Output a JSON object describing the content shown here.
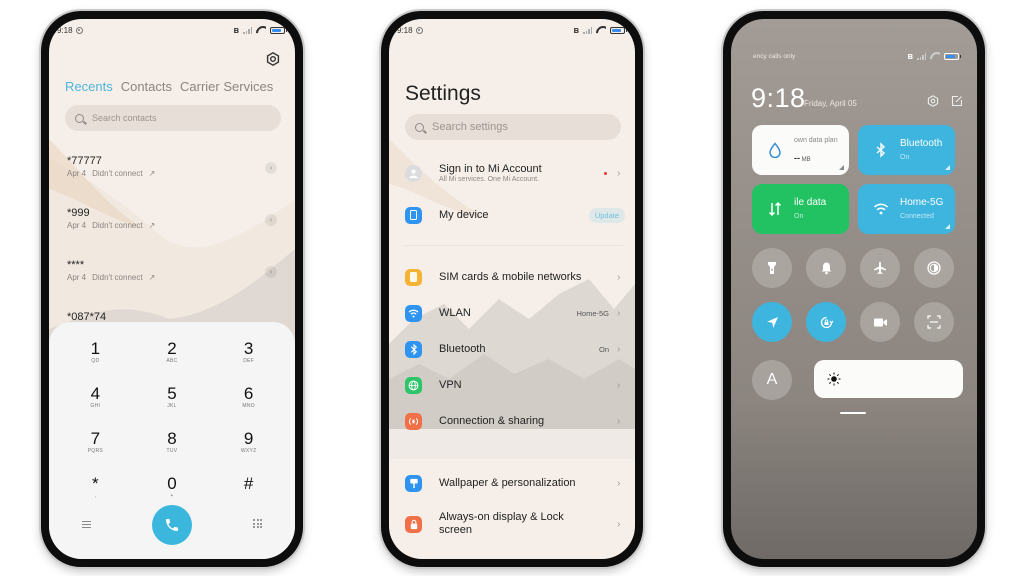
{
  "status_bar": {
    "time": "9:18"
  },
  "phone_app": {
    "tabs": [
      {
        "label": "Recents",
        "active": true
      },
      {
        "label": "Contacts",
        "active": false
      },
      {
        "label": "Carrier Services",
        "active": false
      }
    ],
    "search_placeholder": "Search contacts",
    "recents": [
      {
        "number": "*77777",
        "date": "Apr 4",
        "status": "Didn't connect"
      },
      {
        "number": "*999",
        "date": "Apr 4",
        "status": "Didn't connect"
      },
      {
        "number": "****",
        "date": "Apr 4",
        "status": "Didn't connect"
      },
      {
        "number": "*087*74",
        "date": "",
        "status": ""
      }
    ],
    "keys": [
      {
        "digit": "1",
        "letters": "QD"
      },
      {
        "digit": "2",
        "letters": "ABC"
      },
      {
        "digit": "3",
        "letters": "DEF"
      },
      {
        "digit": "4",
        "letters": "GHI"
      },
      {
        "digit": "5",
        "letters": "JKL"
      },
      {
        "digit": "6",
        "letters": "MNO"
      },
      {
        "digit": "7",
        "letters": "PQRS"
      },
      {
        "digit": "8",
        "letters": "TUV"
      },
      {
        "digit": "9",
        "letters": "WXYZ"
      },
      {
        "digit": "*",
        "letters": ","
      },
      {
        "digit": "0",
        "letters": "+"
      },
      {
        "digit": "#",
        "letters": ""
      }
    ],
    "accent_color": "#3bb6dd"
  },
  "settings_app": {
    "title": "Settings",
    "search_placeholder": "Search settings",
    "account": {
      "label": "Sign in to Mi Account",
      "sub": "All Mi services. One Mi Account."
    },
    "my_device": {
      "label": "My device",
      "badge": "Update"
    },
    "items": [
      {
        "label": "SIM cards & mobile networks",
        "value": "",
        "icon": "sim-card-icon",
        "color": "#f5b335"
      },
      {
        "label": "WLAN",
        "value": "Home-5G",
        "icon": "wifi-icon",
        "color": "#2f93f0"
      },
      {
        "label": "Bluetooth",
        "value": "On",
        "icon": "bluetooth-icon",
        "color": "#2f93f0"
      },
      {
        "label": "VPN",
        "value": "",
        "icon": "globe-icon",
        "color": "#2ec46a"
      },
      {
        "label": "Connection & sharing",
        "value": "",
        "icon": "connection-sharing-icon",
        "color": "#f07048"
      }
    ],
    "personal_items": [
      {
        "label": "Wallpaper & personalization",
        "icon": "wallpaper-icon",
        "color": "#2f93f0"
      },
      {
        "label": "Always-on display & Lock screen",
        "icon": "lock-icon",
        "color": "#f07048"
      }
    ]
  },
  "control_center": {
    "carrier_text": "ency calls only",
    "time": "9:18",
    "date": "Friday, April 05",
    "tiles": {
      "data_plan": {
        "title": "own data plan",
        "value": "--",
        "unit": "MB"
      },
      "bluetooth": {
        "title": "Bluetooth",
        "sub": "On"
      },
      "mobile_data": {
        "title": "ile data",
        "sub": "On"
      },
      "wifi": {
        "title": "Home-5G",
        "sub": "Connected"
      }
    },
    "toggles": [
      {
        "name": "flashlight",
        "on": false
      },
      {
        "name": "silent",
        "on": false
      },
      {
        "name": "airplane-mode",
        "on": false
      },
      {
        "name": "dark-mode",
        "on": false
      },
      {
        "name": "location",
        "on": true
      },
      {
        "name": "rotation-lock",
        "on": true
      },
      {
        "name": "screen-recorder",
        "on": false
      },
      {
        "name": "scanner",
        "on": false
      }
    ],
    "auto_brightness_label": "A",
    "brightness_level": 0.0
  }
}
